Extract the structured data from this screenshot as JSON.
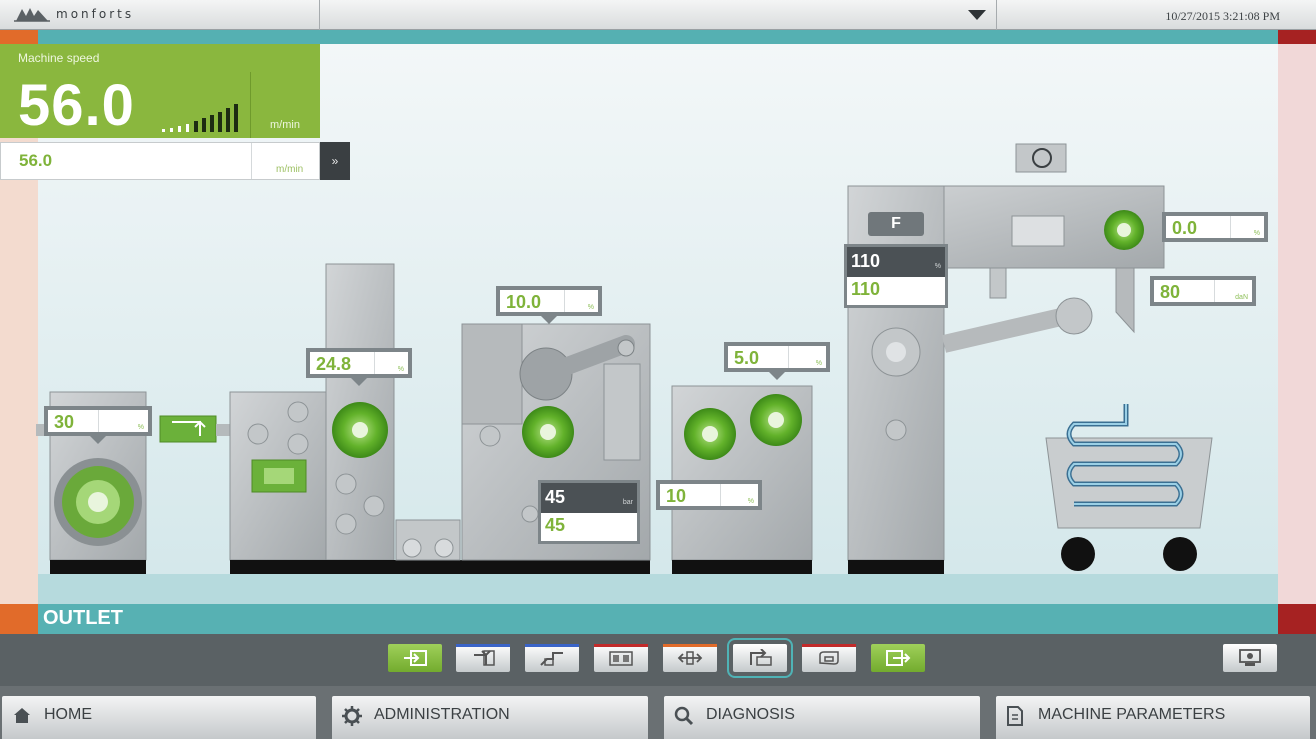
{
  "header": {
    "brand": "monforts",
    "datetime": "10/27/2015 3:21:08 PM"
  },
  "speed_panel": {
    "title": "Machine speed",
    "actual": "56.0",
    "setpoint": "56.0",
    "unit": "m/min",
    "signal_level": 1.0,
    "forward_symbol": "»"
  },
  "machine": {
    "values": {
      "unwinder": "30",
      "roller_1": "24.8",
      "roller_2": "10.0",
      "press_actual": "45",
      "press_setpoint": "45",
      "rollers_3": "5.0",
      "rollers_3_low": "10",
      "dryer_actual": "110",
      "dryer_setpoint": "110",
      "dryer_button": "F",
      "winder_top": "0.0",
      "winder_tension": "80"
    }
  },
  "section": {
    "name": "OUTLET"
  },
  "section_buttons": [
    {
      "icon": "inlet-icon",
      "color": "#8cc04a"
    },
    {
      "icon": "feed-icon",
      "color": "#3a64c8"
    },
    {
      "icon": "padder-icon",
      "color": "#3a64c8"
    },
    {
      "icon": "dryer-icon",
      "color": "#c22a2a"
    },
    {
      "icon": "stretch-icon",
      "color": "#e16b2a"
    },
    {
      "icon": "outlet-icon",
      "color": "#57b1b3"
    },
    {
      "icon": "cooling-icon",
      "color": "#c22a2a"
    },
    {
      "icon": "exit-icon",
      "color": "#8cc04a"
    }
  ],
  "nav": {
    "home": "HOME",
    "administration": "ADMINISTRATION",
    "diagnosis": "DIAGNOSIS",
    "machine_parameters": "MACHINE PARAMETERS"
  },
  "colors": {
    "accent_green": "#8ab73e",
    "teal": "#57b1b3",
    "orange": "#e16b2a",
    "red": "#a62222"
  }
}
